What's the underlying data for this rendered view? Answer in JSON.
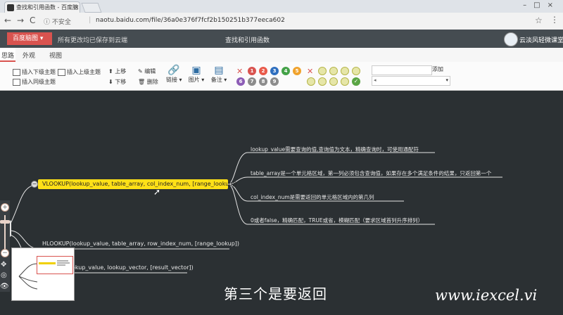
{
  "browser": {
    "tab_title": "查找和引用函数 - 百度脑",
    "tab_close": "×",
    "security_label": "不安全",
    "url": "naotu.baidu.com/file/36a0e376f7fcf2b150251b377eeca602",
    "back_icon": "←",
    "forward_icon": "→",
    "reload_icon": "C",
    "info_icon": "ⓘ",
    "star_icon": "☆",
    "menu_icon": "⋮",
    "window_controls": "–□×"
  },
  "app": {
    "save_button": "百度脑图 ▾",
    "save_status": "所有更改均已保存到云端",
    "doc_title": "查找和引用函数",
    "user_name": "云淡风轻微课堂"
  },
  "ribbon_tabs": [
    "思路",
    "外观",
    "视图"
  ],
  "toolbar": {
    "insert_child": "插入下级主题",
    "insert_parent": "插入上级主题",
    "insert_sibling": "插入同级主题",
    "move_up": "上移",
    "move_down": "下移",
    "edit": "编辑",
    "delete": "删除",
    "link": "链接 ▾",
    "image": "图片 ▾",
    "note": "备注 ▾",
    "priorities": [
      "1",
      "2",
      "3",
      "4",
      "5",
      "6",
      "7",
      "8",
      "9"
    ],
    "priority_colors": [
      "#d9534f",
      "#e95a4a",
      "#2f6fbf",
      "#44a248",
      "#f0a22c",
      "#8d5db6",
      "#8c8c8c",
      "#8c8c8c",
      "#8c8c8c"
    ],
    "search_button": "添加"
  },
  "mindmap": {
    "vlookup": "VLOOKUP(lookup_value, table_array, col_index_num, [range_lookup])",
    "args": [
      "lookup_value需要查询的值,查询值为文本，精确查询时，可使用通配符",
      "table_array是一个单元格区域，第一列必须包含查询值，如果存在多个满足条件的结果，只返回第一个",
      "col_index_num是需要返回的单元格区域内的第几列",
      "0或者false，精确匹配，TRUE或省，模糊匹配（要求区域首列升序排列）"
    ],
    "hlookup": "HLOOKUP(lookup_value, table_array, row_index_num, [range_lookup])",
    "lookup": "LOOKUP(lookup_value, lookup_vector, [result_vector])",
    "lookup_visible": "okup_value, lookup_vector, [result_vector])"
  },
  "overlay": {
    "subtitle": "第三个是要返回",
    "watermark": "www.iexcel.vi"
  }
}
